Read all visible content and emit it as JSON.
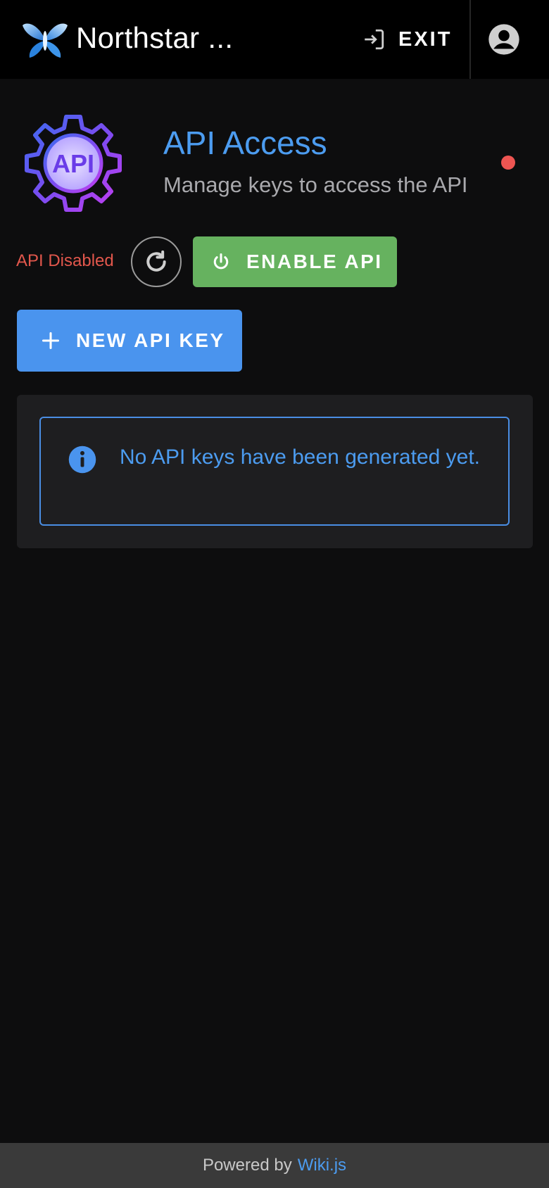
{
  "header": {
    "brand": "Northstar ...",
    "exit_label": "EXIT",
    "icons": {
      "logo": "butterfly-logo",
      "exit": "exit-icon",
      "account": "account-circle-icon"
    }
  },
  "page": {
    "title": "API Access",
    "subtitle": "Manage keys to access the API",
    "icon": "api-gear-icon",
    "status_color": "#ee5552"
  },
  "controls": {
    "api_status": "API Disabled",
    "refresh_icon": "refresh-icon",
    "enable_label": "ENABLE API",
    "enable_icon": "power-icon",
    "new_key_label": "NEW API KEY",
    "new_key_icon": "plus-icon"
  },
  "keys": {
    "empty_message": "No API keys have been generated yet.",
    "info_icon": "info-icon"
  },
  "footer": {
    "prefix": "Powered by",
    "link": "Wiki.js"
  },
  "colors": {
    "accent": "#4c9cf0",
    "primary_button": "#4a94ee",
    "success_button": "#66b25f",
    "error": "#e2574c"
  }
}
